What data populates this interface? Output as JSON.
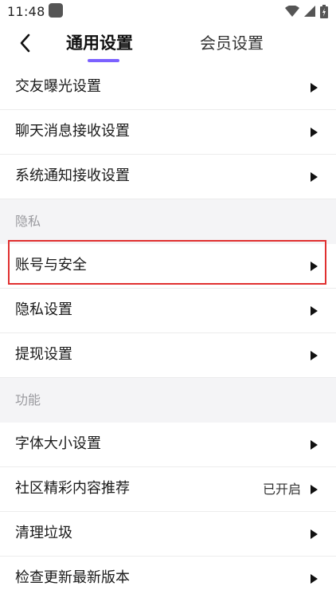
{
  "status_bar": {
    "time": "11:48"
  },
  "header": {
    "back_icon": "chevron-left-icon",
    "tabs": [
      {
        "label": "通用设置",
        "active": true
      },
      {
        "label": "会员设置",
        "active": false
      }
    ],
    "accent_color": "#7b61ff"
  },
  "list": {
    "rows_top": [
      {
        "label": "交友曝光设置"
      },
      {
        "label": "聊天消息接收设置"
      },
      {
        "label": "系统通知接收设置"
      }
    ],
    "section_privacy": {
      "label": "隐私"
    },
    "rows_privacy": [
      {
        "label": "账号与安全"
      },
      {
        "label": "隐私设置"
      },
      {
        "label": "提现设置"
      }
    ],
    "section_features": {
      "label": "功能"
    },
    "rows_features": [
      {
        "label": "字体大小设置"
      },
      {
        "label": "社区精彩内容推荐",
        "value": "已开启"
      },
      {
        "label": "清理垃圾"
      },
      {
        "label": "检查更新最新版本"
      }
    ]
  },
  "highlight_color": "#e03030"
}
